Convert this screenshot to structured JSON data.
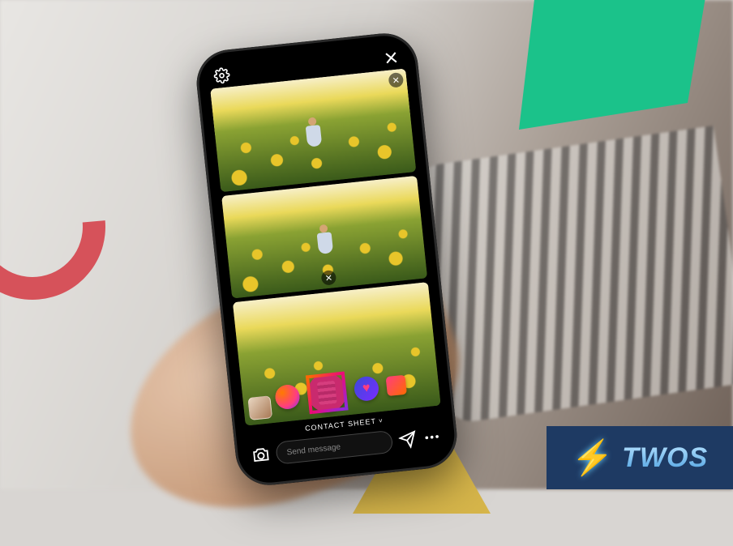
{
  "app": {
    "mode_label": "CONTACT SHEET",
    "message_placeholder": "Send message"
  },
  "icons": {
    "settings": "gear-icon",
    "close": "close-icon",
    "frame_remove": "remove-frame-icon",
    "camera": "camera-icon",
    "send": "send-icon",
    "more": "more-icon"
  },
  "stickers": [
    {
      "name": "gradient-orb-sticker"
    },
    {
      "name": "film-reel-sticker"
    },
    {
      "name": "heart-sticker"
    },
    {
      "name": "square-sticker"
    }
  ],
  "frames": [
    {
      "position": "top",
      "subject": "sunflower-field-person"
    },
    {
      "position": "middle",
      "subject": "sunflower-field-person"
    },
    {
      "position": "bottom",
      "subject": "sunflower-field-stickers"
    }
  ],
  "badge": {
    "text": "TWOS",
    "icon": "⚡"
  },
  "colors": {
    "green_shape": "#1bc28a",
    "red_shape": "#d6525a",
    "yellow_shape": "#d6b54a",
    "badge_bg": "#1e3a63"
  }
}
